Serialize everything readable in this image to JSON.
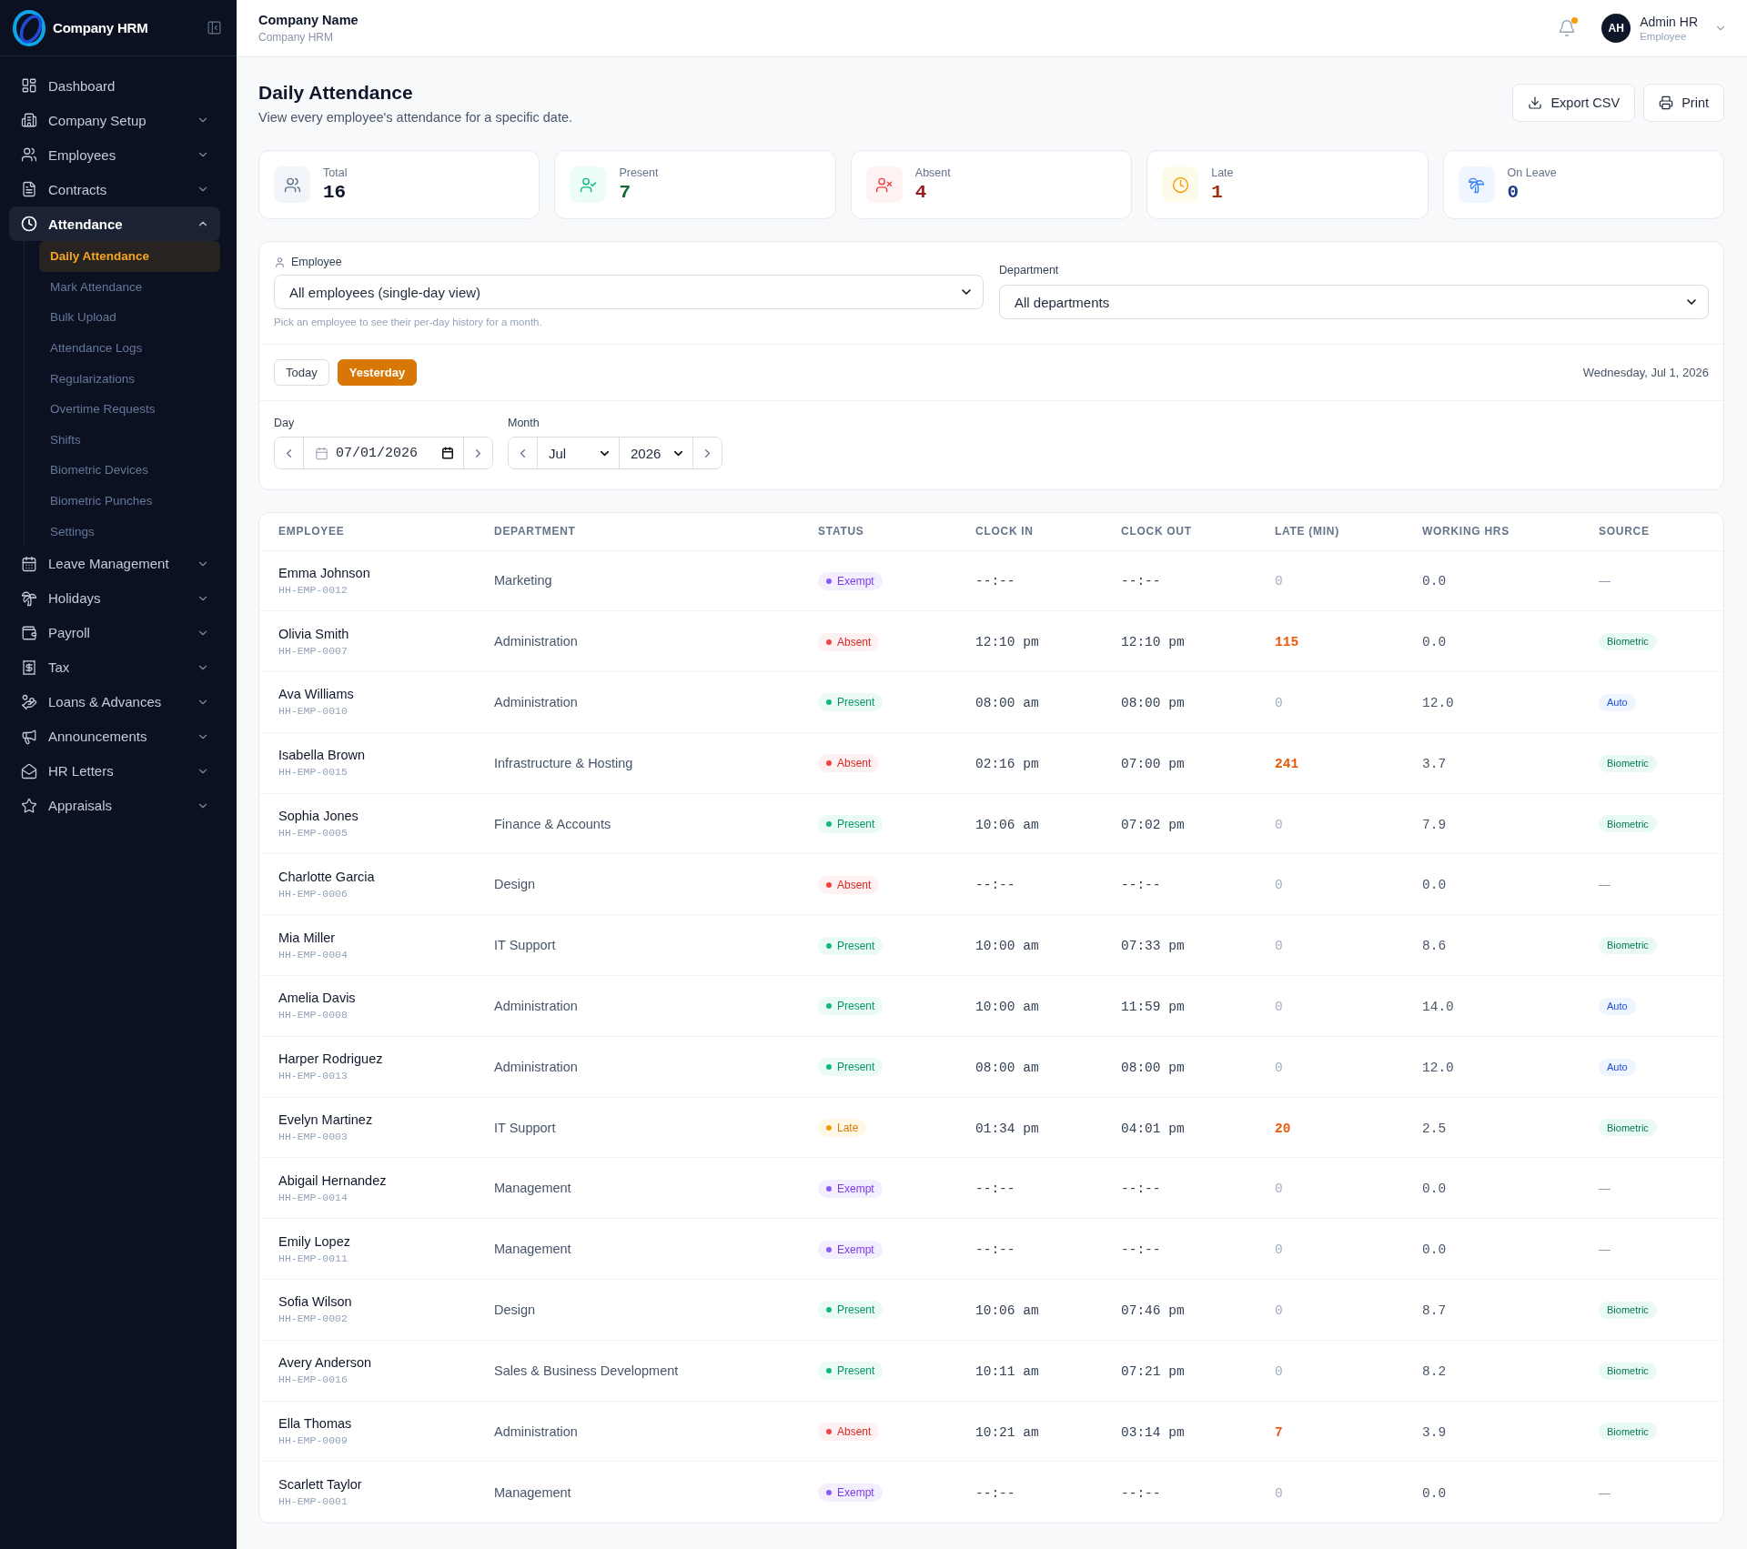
{
  "sidebar": {
    "brand": "Company HRM",
    "nav": [
      {
        "label": "Dashboard",
        "kind": "link",
        "selected": false
      },
      {
        "label": "Company Setup",
        "kind": "group",
        "expanded": false,
        "selected": false
      },
      {
        "label": "Employees",
        "kind": "group",
        "expanded": false,
        "selected": false
      },
      {
        "label": "Contracts",
        "kind": "group",
        "expanded": false,
        "selected": false
      },
      {
        "label": "Attendance",
        "kind": "group",
        "expanded": true,
        "selected": true,
        "children": [
          {
            "label": "Daily Attendance",
            "selected": true
          },
          {
            "label": "Mark Attendance",
            "selected": false
          },
          {
            "label": "Bulk Upload",
            "selected": false
          },
          {
            "label": "Attendance Logs",
            "selected": false
          },
          {
            "label": "Regularizations",
            "selected": false
          },
          {
            "label": "Overtime Requests",
            "selected": false
          },
          {
            "label": "Shifts",
            "selected": false
          },
          {
            "label": "Biometric Devices",
            "selected": false
          },
          {
            "label": "Biometric Punches",
            "selected": false
          },
          {
            "label": "Settings",
            "selected": false
          }
        ]
      },
      {
        "label": "Leave Management",
        "kind": "group",
        "expanded": false,
        "selected": false
      },
      {
        "label": "Holidays",
        "kind": "group",
        "expanded": false,
        "selected": false
      },
      {
        "label": "Payroll",
        "kind": "group",
        "expanded": false,
        "selected": false
      },
      {
        "label": "Tax",
        "kind": "group",
        "expanded": false,
        "selected": false
      },
      {
        "label": "Loans & Advances",
        "kind": "group",
        "expanded": false,
        "selected": false
      },
      {
        "label": "Announcements",
        "kind": "group",
        "expanded": false,
        "selected": false
      },
      {
        "label": "HR Letters",
        "kind": "group",
        "expanded": false,
        "selected": false
      },
      {
        "label": "Appraisals",
        "kind": "group",
        "expanded": false,
        "selected": false
      }
    ]
  },
  "topbar": {
    "company_name": "Company Name",
    "company_subtitle": "Company HRM",
    "notification_unread": true,
    "user": {
      "initials": "AH",
      "name": "Admin HR",
      "role": "Employee"
    }
  },
  "page": {
    "title": "Daily Attendance",
    "subtitle": "View every employee's attendance for a specific date.",
    "actions": [
      {
        "label": "Export CSV",
        "kind": "export"
      },
      {
        "label": "Print",
        "kind": "print"
      }
    ]
  },
  "stats": [
    {
      "label": "Total",
      "value": "16",
      "kind": "total"
    },
    {
      "label": "Present",
      "value": "7",
      "kind": "present"
    },
    {
      "label": "Absent",
      "value": "4",
      "kind": "absent"
    },
    {
      "label": "Late",
      "value": "1",
      "kind": "late"
    },
    {
      "label": "On Leave",
      "value": "0",
      "kind": "leave"
    }
  ],
  "filters": {
    "employee": {
      "label": "Employee",
      "value": "All employees (single-day view)",
      "hint": "Pick an employee to see their per-day history for a month."
    },
    "department": {
      "label": "Department",
      "value": "All departments"
    },
    "quick_dates": [
      {
        "label": "Today",
        "selected": false
      },
      {
        "label": "Yesterday",
        "selected": true
      }
    ],
    "date_display": "Wednesday, Jul 1, 2026",
    "day": {
      "label": "Day",
      "value": "07/01/2026"
    },
    "month": {
      "label": "Month",
      "month": "Jul",
      "year": "2026"
    }
  },
  "table": {
    "columns": [
      "EMPLOYEE",
      "DEPARTMENT",
      "STATUS",
      "CLOCK IN",
      "CLOCK OUT",
      "LATE (MIN)",
      "WORKING HRS",
      "SOURCE"
    ],
    "rows": [
      {
        "name": "Emma Johnson",
        "id": "HH-EMP-0012",
        "department": "Marketing",
        "status": {
          "label": "Exempt",
          "kind": "exempt"
        },
        "clock_in": "--:--",
        "clock_out": "--:--",
        "late_min": "0",
        "late_flagged": false,
        "working_hrs": "0.0",
        "source": {
          "label": "—",
          "kind": "none"
        }
      },
      {
        "name": "Olivia Smith",
        "id": "HH-EMP-0007",
        "department": "Administration",
        "status": {
          "label": "Absent",
          "kind": "absent"
        },
        "clock_in": "12:10 pm",
        "clock_out": "12:10 pm",
        "late_min": "115",
        "late_flagged": true,
        "working_hrs": "0.0",
        "source": {
          "label": "Biometric",
          "kind": "biometric"
        }
      },
      {
        "name": "Ava Williams",
        "id": "HH-EMP-0010",
        "department": "Administration",
        "status": {
          "label": "Present",
          "kind": "present"
        },
        "clock_in": "08:00 am",
        "clock_out": "08:00 pm",
        "late_min": "0",
        "late_flagged": false,
        "working_hrs": "12.0",
        "source": {
          "label": "Auto",
          "kind": "auto"
        }
      },
      {
        "name": "Isabella Brown",
        "id": "HH-EMP-0015",
        "department": "Infrastructure & Hosting",
        "status": {
          "label": "Absent",
          "kind": "absent"
        },
        "clock_in": "02:16 pm",
        "clock_out": "07:00 pm",
        "late_min": "241",
        "late_flagged": true,
        "working_hrs": "3.7",
        "source": {
          "label": "Biometric",
          "kind": "biometric"
        }
      },
      {
        "name": "Sophia Jones",
        "id": "HH-EMP-0005",
        "department": "Finance & Accounts",
        "status": {
          "label": "Present",
          "kind": "present"
        },
        "clock_in": "10:06 am",
        "clock_out": "07:02 pm",
        "late_min": "0",
        "late_flagged": false,
        "working_hrs": "7.9",
        "source": {
          "label": "Biometric",
          "kind": "biometric"
        }
      },
      {
        "name": "Charlotte Garcia",
        "id": "HH-EMP-0006",
        "department": "Design",
        "status": {
          "label": "Absent",
          "kind": "absent"
        },
        "clock_in": "--:--",
        "clock_out": "--:--",
        "late_min": "0",
        "late_flagged": false,
        "working_hrs": "0.0",
        "source": {
          "label": "—",
          "kind": "none"
        }
      },
      {
        "name": "Mia Miller",
        "id": "HH-EMP-0004",
        "department": "IT Support",
        "status": {
          "label": "Present",
          "kind": "present"
        },
        "clock_in": "10:00 am",
        "clock_out": "07:33 pm",
        "late_min": "0",
        "late_flagged": false,
        "working_hrs": "8.6",
        "source": {
          "label": "Biometric",
          "kind": "biometric"
        }
      },
      {
        "name": "Amelia Davis",
        "id": "HH-EMP-0008",
        "department": "Administration",
        "status": {
          "label": "Present",
          "kind": "present"
        },
        "clock_in": "10:00 am",
        "clock_out": "11:59 pm",
        "late_min": "0",
        "late_flagged": false,
        "working_hrs": "14.0",
        "source": {
          "label": "Auto",
          "kind": "auto"
        }
      },
      {
        "name": "Harper Rodriguez",
        "id": "HH-EMP-0013",
        "department": "Administration",
        "status": {
          "label": "Present",
          "kind": "present"
        },
        "clock_in": "08:00 am",
        "clock_out": "08:00 pm",
        "late_min": "0",
        "late_flagged": false,
        "working_hrs": "12.0",
        "source": {
          "label": "Auto",
          "kind": "auto"
        }
      },
      {
        "name": "Evelyn Martinez",
        "id": "HH-EMP-0003",
        "department": "IT Support",
        "status": {
          "label": "Late",
          "kind": "late"
        },
        "clock_in": "01:34 pm",
        "clock_out": "04:01 pm",
        "late_min": "20",
        "late_flagged": true,
        "working_hrs": "2.5",
        "source": {
          "label": "Biometric",
          "kind": "biometric"
        }
      },
      {
        "name": "Abigail Hernandez",
        "id": "HH-EMP-0014",
        "department": "Management",
        "status": {
          "label": "Exempt",
          "kind": "exempt"
        },
        "clock_in": "--:--",
        "clock_out": "--:--",
        "late_min": "0",
        "late_flagged": false,
        "working_hrs": "0.0",
        "source": {
          "label": "—",
          "kind": "none"
        }
      },
      {
        "name": "Emily Lopez",
        "id": "HH-EMP-0011",
        "department": "Management",
        "status": {
          "label": "Exempt",
          "kind": "exempt"
        },
        "clock_in": "--:--",
        "clock_out": "--:--",
        "late_min": "0",
        "late_flagged": false,
        "working_hrs": "0.0",
        "source": {
          "label": "—",
          "kind": "none"
        }
      },
      {
        "name": "Sofia Wilson",
        "id": "HH-EMP-0002",
        "department": "Design",
        "status": {
          "label": "Present",
          "kind": "present"
        },
        "clock_in": "10:06 am",
        "clock_out": "07:46 pm",
        "late_min": "0",
        "late_flagged": false,
        "working_hrs": "8.7",
        "source": {
          "label": "Biometric",
          "kind": "biometric"
        }
      },
      {
        "name": "Avery Anderson",
        "id": "HH-EMP-0016",
        "department": "Sales & Business Development",
        "status": {
          "label": "Present",
          "kind": "present"
        },
        "clock_in": "10:11 am",
        "clock_out": "07:21 pm",
        "late_min": "0",
        "late_flagged": false,
        "working_hrs": "8.2",
        "source": {
          "label": "Biometric",
          "kind": "biometric"
        }
      },
      {
        "name": "Ella Thomas",
        "id": "HH-EMP-0009",
        "department": "Administration",
        "status": {
          "label": "Absent",
          "kind": "absent"
        },
        "clock_in": "10:21 am",
        "clock_out": "03:14 pm",
        "late_min": "7",
        "late_flagged": true,
        "working_hrs": "3.9",
        "source": {
          "label": "Biometric",
          "kind": "biometric"
        }
      },
      {
        "name": "Scarlett Taylor",
        "id": "HH-EMP-0001",
        "department": "Management",
        "status": {
          "label": "Exempt",
          "kind": "exempt"
        },
        "clock_in": "--:--",
        "clock_out": "--:--",
        "late_min": "0",
        "late_flagged": false,
        "working_hrs": "0.0",
        "source": {
          "label": "—",
          "kind": "none"
        }
      }
    ]
  }
}
